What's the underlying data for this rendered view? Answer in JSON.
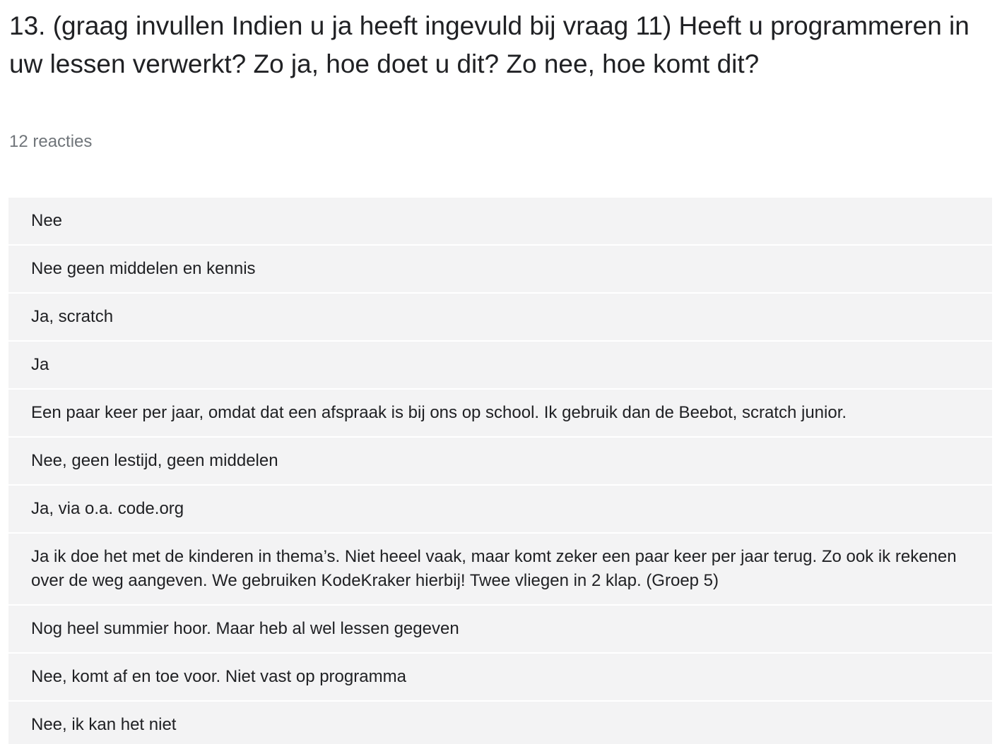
{
  "question": {
    "title": "13. (graag invullen Indien u ja heeft ingevuld bij vraag 11) Heeft u programmeren in uw lessen verwerkt? Zo ja, hoe doet u dit? Zo nee, hoe komt dit?",
    "response_count": "12 reacties"
  },
  "responses": [
    "Nee",
    "Nee geen middelen en kennis",
    "Ja, scratch",
    "Ja",
    "Een paar keer per jaar, omdat dat een afspraak is bij ons op school. Ik gebruik dan de Beebot, scratch junior.",
    "Nee, geen lestijd, geen middelen",
    "Ja, via o.a. code.org",
    "Ja ik doe het met de kinderen in thema’s. Niet heeel vaak, maar komt zeker een paar keer per jaar terug. Zo ook ik rekenen over de weg aangeven. We gebruiken KodeKraker hierbij! Twee vliegen in 2 klap. (Groep 5)",
    "Nog heel summier hoor. Maar heb al wel lessen gegeven",
    "Nee, komt af en toe voor. Niet vast op programma",
    "Nee, ik kan het niet"
  ]
}
